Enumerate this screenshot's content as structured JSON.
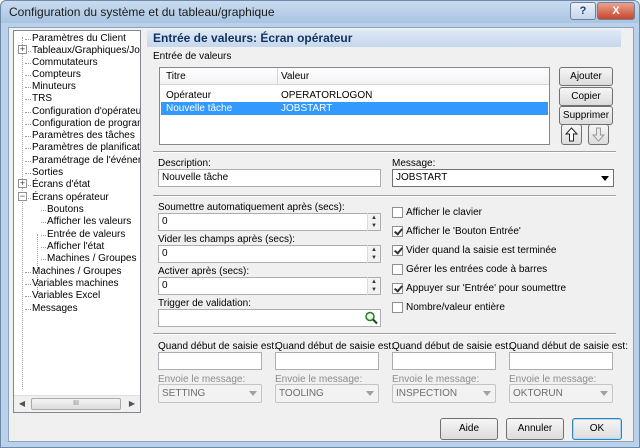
{
  "window": {
    "title": "Configuration du système et du tableau/graphique",
    "help_label": "?",
    "close_label": "X"
  },
  "tree": {
    "items": [
      "Paramètres du Client",
      "Tableaux/Graphiques/Journa",
      "Commutateurs",
      "Compteurs",
      "Minuteurs",
      "TRS",
      "Configuration d'opérateur",
      "Configuration de programme",
      "Paramètres des tâches",
      "Paramètres de planification",
      "Paramétrage de l'événement",
      "Sorties",
      "Écrans d'état",
      "Écrans opérateur",
      "Boutons",
      "Afficher les valeurs",
      "Entrée de valeurs",
      "Afficher l'état",
      "Machines / Groupes",
      "Machines / Groupes",
      "Variables machines",
      "Variables Excel",
      "Messages"
    ],
    "scroll_thumb": "III"
  },
  "panel": {
    "header": "Entrée de valeurs: Écran opérateur",
    "section_label": "Entrée de valeurs",
    "grid": {
      "columns": [
        "Titre",
        "Valeur"
      ],
      "rows": [
        {
          "titre": "Opérateur",
          "valeur": "OPERATORLOGON"
        },
        {
          "titre": "Nouvelle tâche",
          "valeur": "JOBSTART"
        }
      ]
    },
    "buttons": {
      "add": "Ajouter",
      "copy": "Copier",
      "delete": "Supprimer"
    },
    "description_label": "Description:",
    "description_value": "Nouvelle tâche",
    "message_label": "Message:",
    "message_value": "JOBSTART",
    "submit_after_label": "Soumettre automatiquement après (secs):",
    "submit_after_value": "0",
    "clear_after_label": "Vider les champs après (secs):",
    "clear_after_value": "0",
    "activate_after_label": "Activer après (secs):",
    "activate_after_value": "0",
    "trigger_label": "Trigger de validation:",
    "trigger_value": "",
    "checkboxes": [
      {
        "label": "Afficher le clavier",
        "checked": false
      },
      {
        "label": "Afficher le 'Bouton Entrée'",
        "checked": true
      },
      {
        "label": "Vider quand la saisie est terminée",
        "checked": true
      },
      {
        "label": "Gérer les entrées code à barres",
        "checked": false
      },
      {
        "label": "Appuyer sur 'Entrée' pour soumettre",
        "checked": true
      },
      {
        "label": "Nombre/valeur entière",
        "checked": false
      }
    ],
    "entry_start": [
      {
        "label": "Quand début de saisie est:",
        "value": "",
        "send_label": "Envoie le message:",
        "message": "SETTING"
      },
      {
        "label": "Quand début de saisie est:",
        "value": "",
        "send_label": "Envoie le message:",
        "message": "TOOLING"
      },
      {
        "label": "Quand début de saisie est:",
        "value": "",
        "send_label": "Envoie le message:",
        "message": "INSPECTION"
      },
      {
        "label": "Quand début de saisie est:",
        "value": "",
        "send_label": "Envoie le message:",
        "message": "OKTORUN"
      }
    ]
  },
  "footer": {
    "help": "Aide",
    "cancel": "Annuler",
    "ok": "OK"
  },
  "colors": {
    "selection": "#3399ff",
    "header_text": "#10325e",
    "frame": "#b9d1ea"
  }
}
